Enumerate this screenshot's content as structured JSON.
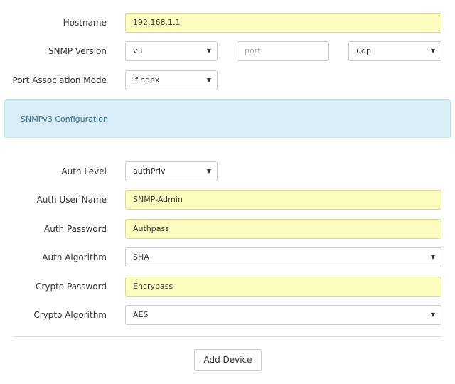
{
  "form": {
    "hostname": {
      "label": "Hostname",
      "value": "192.168.1.1"
    },
    "snmp_version": {
      "label": "SNMP Version",
      "value": "v3",
      "port_placeholder": "port",
      "transport_value": "udp"
    },
    "port_association_mode": {
      "label": "Port Association Mode",
      "value": "ifIndex"
    },
    "snmpv3_panel_title": "SNMPv3 Configuration",
    "auth_level": {
      "label": "Auth Level",
      "value": "authPriv"
    },
    "auth_user_name": {
      "label": "Auth User Name",
      "value": "SNMP-Admin"
    },
    "auth_password": {
      "label": "Auth Password",
      "value": "Authpass"
    },
    "auth_algorithm": {
      "label": "Auth Algorithm",
      "value": "SHA"
    },
    "crypto_password": {
      "label": "Crypto Password",
      "value": "Encrypass"
    },
    "crypto_algorithm": {
      "label": "Crypto Algorithm",
      "value": "AES"
    },
    "submit_label": "Add Device"
  },
  "icons": {
    "dropdown_arrow": "▼"
  },
  "colors": {
    "filled_field_bg": "#fcfcbf",
    "panel_bg": "#d9edf7",
    "panel_text": "#31708f"
  }
}
